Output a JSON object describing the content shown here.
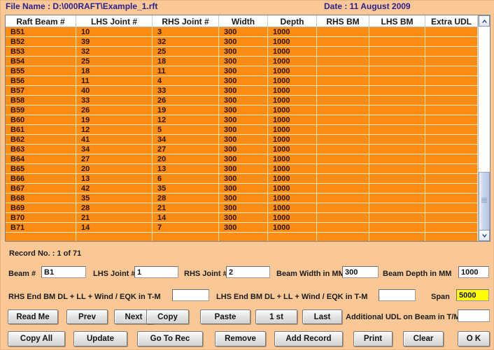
{
  "header": {
    "file_label": "File Name : D:\\000RAFT\\Example_1.rft",
    "date_label": "Date : 11 August 2009",
    "title_color": "#2a1f8f"
  },
  "grid": {
    "columns": [
      "Raft Beam #",
      "LHS Joint #",
      "RHS Joint #",
      "Width",
      "Depth",
      "RHS BM",
      "LHS BM",
      "Extra UDL"
    ],
    "row_color": "#fd8c14",
    "rows": [
      [
        "B51",
        "10",
        "3",
        "300",
        "1000",
        "",
        "",
        ""
      ],
      [
        "B52",
        "39",
        "32",
        "300",
        "1000",
        "",
        "",
        ""
      ],
      [
        "B53",
        "32",
        "25",
        "300",
        "1000",
        "",
        "",
        ""
      ],
      [
        "B54",
        "25",
        "18",
        "300",
        "1000",
        "",
        "",
        ""
      ],
      [
        "B55",
        "18",
        "11",
        "300",
        "1000",
        "",
        "",
        ""
      ],
      [
        "B56",
        "11",
        "4",
        "300",
        "1000",
        "",
        "",
        ""
      ],
      [
        "B57",
        "40",
        "33",
        "300",
        "1000",
        "",
        "",
        ""
      ],
      [
        "B58",
        "33",
        "26",
        "300",
        "1000",
        "",
        "",
        ""
      ],
      [
        "B59",
        "26",
        "19",
        "300",
        "1000",
        "",
        "",
        ""
      ],
      [
        "B60",
        "19",
        "12",
        "300",
        "1000",
        "",
        "",
        ""
      ],
      [
        "B61",
        "12",
        "5",
        "300",
        "1000",
        "",
        "",
        ""
      ],
      [
        "B62",
        "41",
        "34",
        "300",
        "1000",
        "",
        "",
        ""
      ],
      [
        "B63",
        "34",
        "27",
        "300",
        "1000",
        "",
        "",
        ""
      ],
      [
        "B64",
        "27",
        "20",
        "300",
        "1000",
        "",
        "",
        ""
      ],
      [
        "B65",
        "20",
        "13",
        "300",
        "1000",
        "",
        "",
        ""
      ],
      [
        "B66",
        "13",
        "6",
        "300",
        "1000",
        "",
        "",
        ""
      ],
      [
        "B67",
        "42",
        "35",
        "300",
        "1000",
        "",
        "",
        ""
      ],
      [
        "B68",
        "35",
        "28",
        "300",
        "1000",
        "",
        "",
        ""
      ],
      [
        "B69",
        "28",
        "21",
        "300",
        "1000",
        "",
        "",
        ""
      ],
      [
        "B70",
        "21",
        "14",
        "300",
        "1000",
        "",
        "",
        ""
      ],
      [
        "B71",
        "14",
        "7",
        "300",
        "1000",
        "",
        "",
        ""
      ]
    ]
  },
  "scrollbar": {
    "up_icon": "chevron-up-icon",
    "down_icon": "chevron-down-icon"
  },
  "status": {
    "record_no": "Record No. : 1 of 71"
  },
  "form": {
    "beam_label": "Beam #",
    "beam_value": "B1",
    "lhs_joint_label": "LHS Joint #",
    "lhs_joint_value": "1",
    "rhs_joint_label": "RHS Joint #",
    "rhs_joint_value": "2",
    "beam_width_label": "Beam Width in MM",
    "beam_width_value": "300",
    "beam_depth_label": "Beam Depth in MM",
    "beam_depth_value": "1000",
    "rhs_end_bm_label": "RHS End BM DL + LL + Wind / EQK in T-M",
    "rhs_end_bm_value": "",
    "lhs_end_bm_label": "LHS End BM DL + LL + Wind / EQK in T-M",
    "lhs_end_bm_value": "",
    "span_label": "Span",
    "span_value": "5000",
    "span_highlight_color": "#ffff00",
    "additional_udl_label": "Additional UDL on Beam in T/M",
    "additional_udl_value": ""
  },
  "buttons": {
    "read_me": "Read Me",
    "prev": "Prev",
    "next": "Next",
    "copy": "Copy",
    "paste": "Paste",
    "first": "1 st",
    "last": "Last",
    "copy_all": "Copy All",
    "update": "Update",
    "go_to_rec": "Go To Rec",
    "remove": "Remove",
    "add_record": "Add Record",
    "print": "Print",
    "clear": "Clear",
    "ok": "O K"
  }
}
